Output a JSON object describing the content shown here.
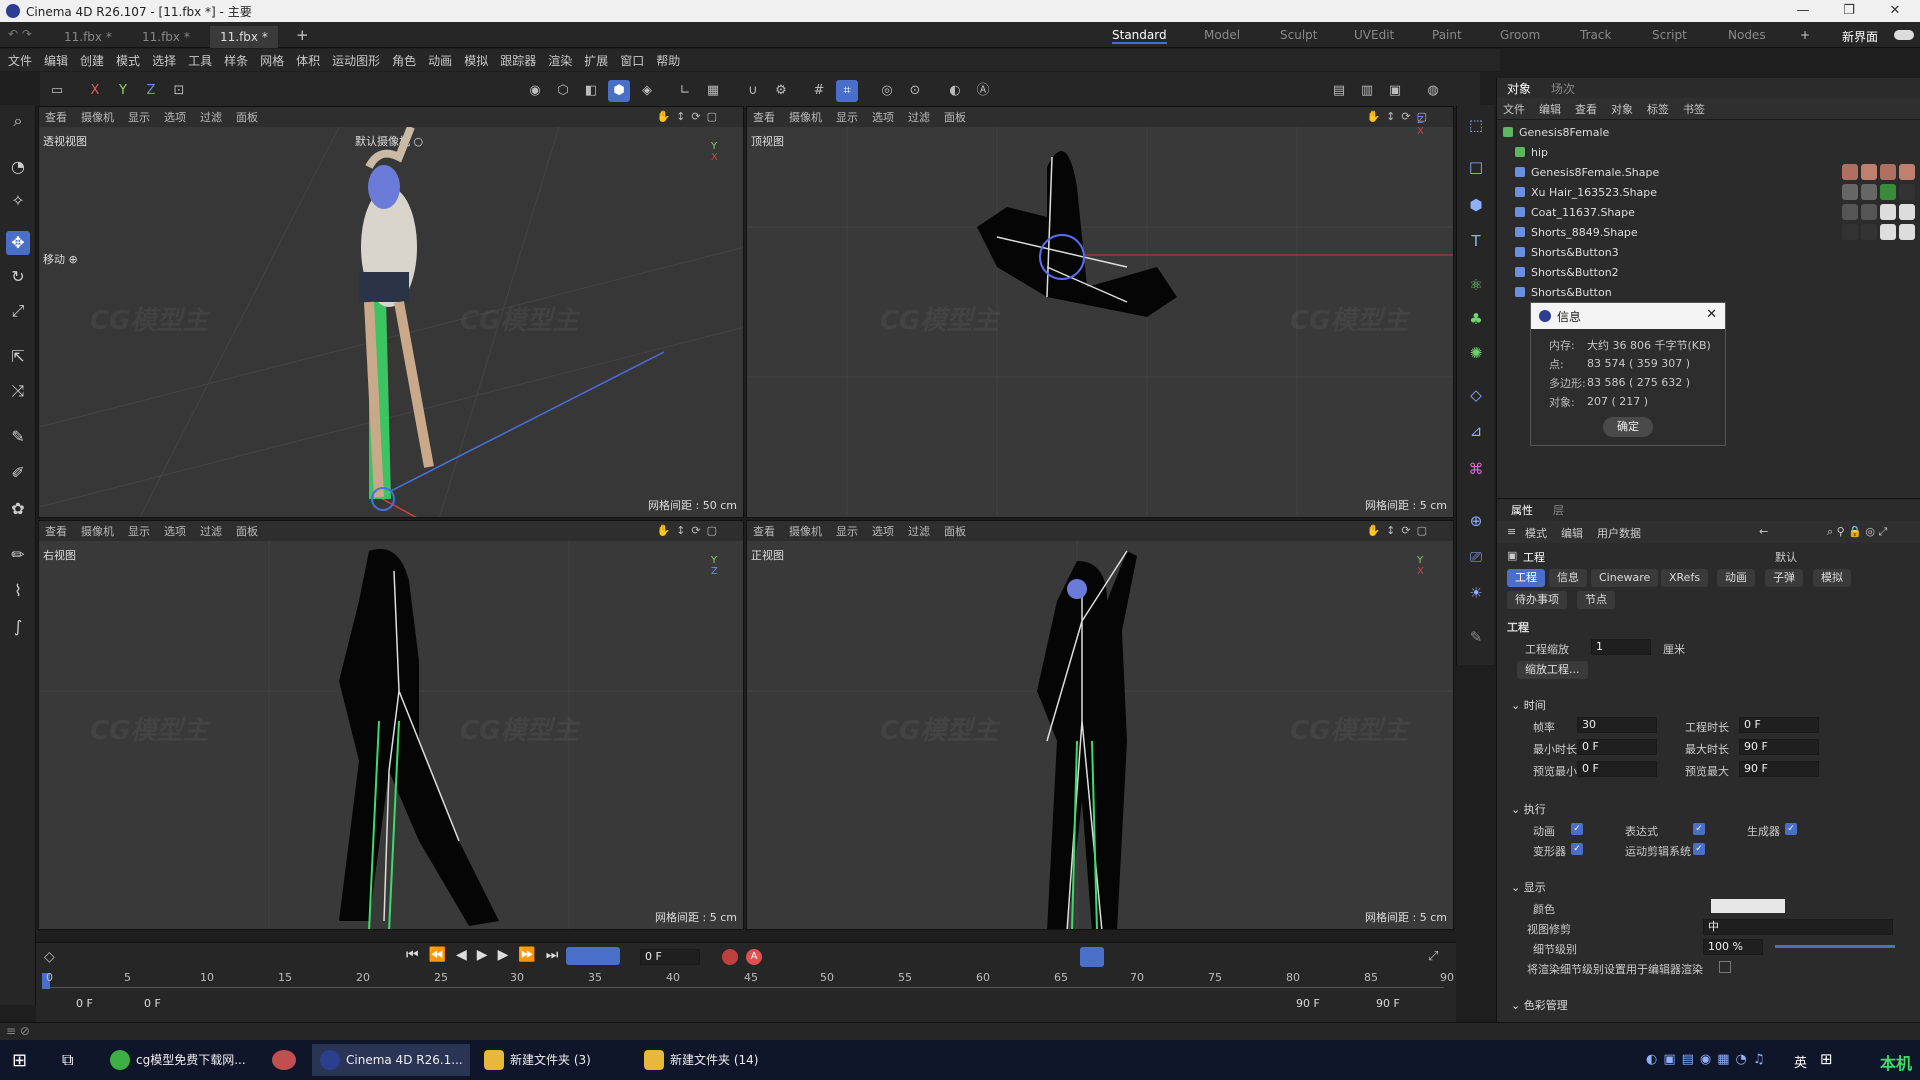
{
  "window": {
    "title": "Cinema 4D R26.107 - [11.fbx *] - 主要",
    "minimize": "—",
    "maximize": "❐",
    "close": "✕"
  },
  "doc_tabs": [
    "11.fbx *",
    "11.fbx *",
    "11.fbx *"
  ],
  "new_tab": "+",
  "layouts": [
    "Standard",
    "Model",
    "Sculpt",
    "UVEdit",
    "Paint",
    "Groom",
    "Track",
    "Script",
    "Nodes"
  ],
  "new_layout": "新界面",
  "menu": [
    "文件",
    "编辑",
    "创建",
    "模式",
    "选择",
    "工具",
    "样条",
    "网格",
    "体积",
    "运动图形",
    "角色",
    "动画",
    "模拟",
    "跟踪器",
    "渲染",
    "扩展",
    "窗口",
    "帮助"
  ],
  "toolbar": {
    "x": "X",
    "y": "Y",
    "z": "Z"
  },
  "viewport_menu": [
    "查看",
    "摄像机",
    "显示",
    "选项",
    "过滤",
    "面板"
  ],
  "viewports": [
    {
      "title": "透视视图",
      "camera": "默认摄像机 ○",
      "grid": "网格间距 : 50 cm",
      "move_label": "移动 ⊕"
    },
    {
      "title": "顶视图",
      "grid": "网格间距 : 5 cm"
    },
    {
      "title": "右视图",
      "grid": "网格间距 : 5 cm"
    },
    {
      "title": "正视图",
      "grid": "网格间距 : 5 cm"
    }
  ],
  "object_manager": {
    "tabs": [
      "对象",
      "场次"
    ],
    "menu": [
      "文件",
      "编辑",
      "查看",
      "对象",
      "标签",
      "书签"
    ],
    "objects": [
      "Genesis8Female",
      "hip",
      "Genesis8Female.Shape",
      "Xu Hair_163523.Shape",
      "Coat_11637.Shape",
      "Shorts_8849.Shape",
      "Shorts&Button3",
      "Shorts&Button2",
      "Shorts&Button"
    ]
  },
  "info_dialog": {
    "title": "信息",
    "rows": [
      {
        "k": "内存:",
        "v": "大约 36 806 千字节(KB)"
      },
      {
        "k": "点:",
        "v": "83 574 ( 359 307 )"
      },
      {
        "k": "多边形:",
        "v": "83 586 ( 275 632 )"
      },
      {
        "k": "对象:",
        "v": "207 ( 217 )"
      }
    ],
    "ok": "确定"
  },
  "attributes": {
    "tabs": [
      "属性",
      "层"
    ],
    "menu": [
      "模式",
      "编辑",
      "用户数据"
    ],
    "preset": "默认",
    "title": "工程",
    "pills": [
      "工程",
      "信息",
      "Cineware",
      "XRefs",
      "动画",
      "子弹",
      "模拟"
    ],
    "pills2": [
      "待办事项",
      "节点"
    ],
    "section_project": "工程",
    "scale_label": "工程缩放",
    "scale_value": "1",
    "scale_unit": "厘米",
    "scale_btn": "缩放工程...",
    "section_time": "时间",
    "fps_label": "帧率",
    "fps": "30",
    "dur_label": "工程时长",
    "dur": "0 F",
    "min_label": "最小时长",
    "min": "0 F",
    "max_label": "最大时长",
    "max": "90 F",
    "pmin_label": "预览最小",
    "pmin": "0 F",
    "pmax_label": "预览最大",
    "pmax": "90 F",
    "section_exec": "执行",
    "exec": [
      "动画",
      "表达式",
      "生成器",
      "变形器",
      "运动剪辑系统"
    ],
    "section_display": "显示",
    "color_label": "颜色",
    "lod_label": "视图修剪",
    "lod_value": "中",
    "detail_label": "细节级别",
    "detail_value": "100 %",
    "render_lod": "将渲染细节级别设置用于编辑器渲染",
    "section_color": "色彩管理"
  },
  "timeline": {
    "current": "0 F",
    "ticks": [
      "0",
      "5",
      "10",
      "15",
      "20",
      "25",
      "30",
      "35",
      "40",
      "45",
      "50",
      "55",
      "60",
      "65",
      "70",
      "75",
      "80",
      "85",
      "90"
    ],
    "start": "0 F",
    "start2": "0 F",
    "end": "90 F",
    "end2": "90 F"
  },
  "taskbar": {
    "items": [
      "cg模型免费下载网...",
      "Cinema 4D R26.1...",
      "新建文件夹 (3)",
      "新建文件夹 (14)"
    ],
    "ime": "英",
    "tray_text": "本机"
  },
  "watermark": "CG模型主"
}
